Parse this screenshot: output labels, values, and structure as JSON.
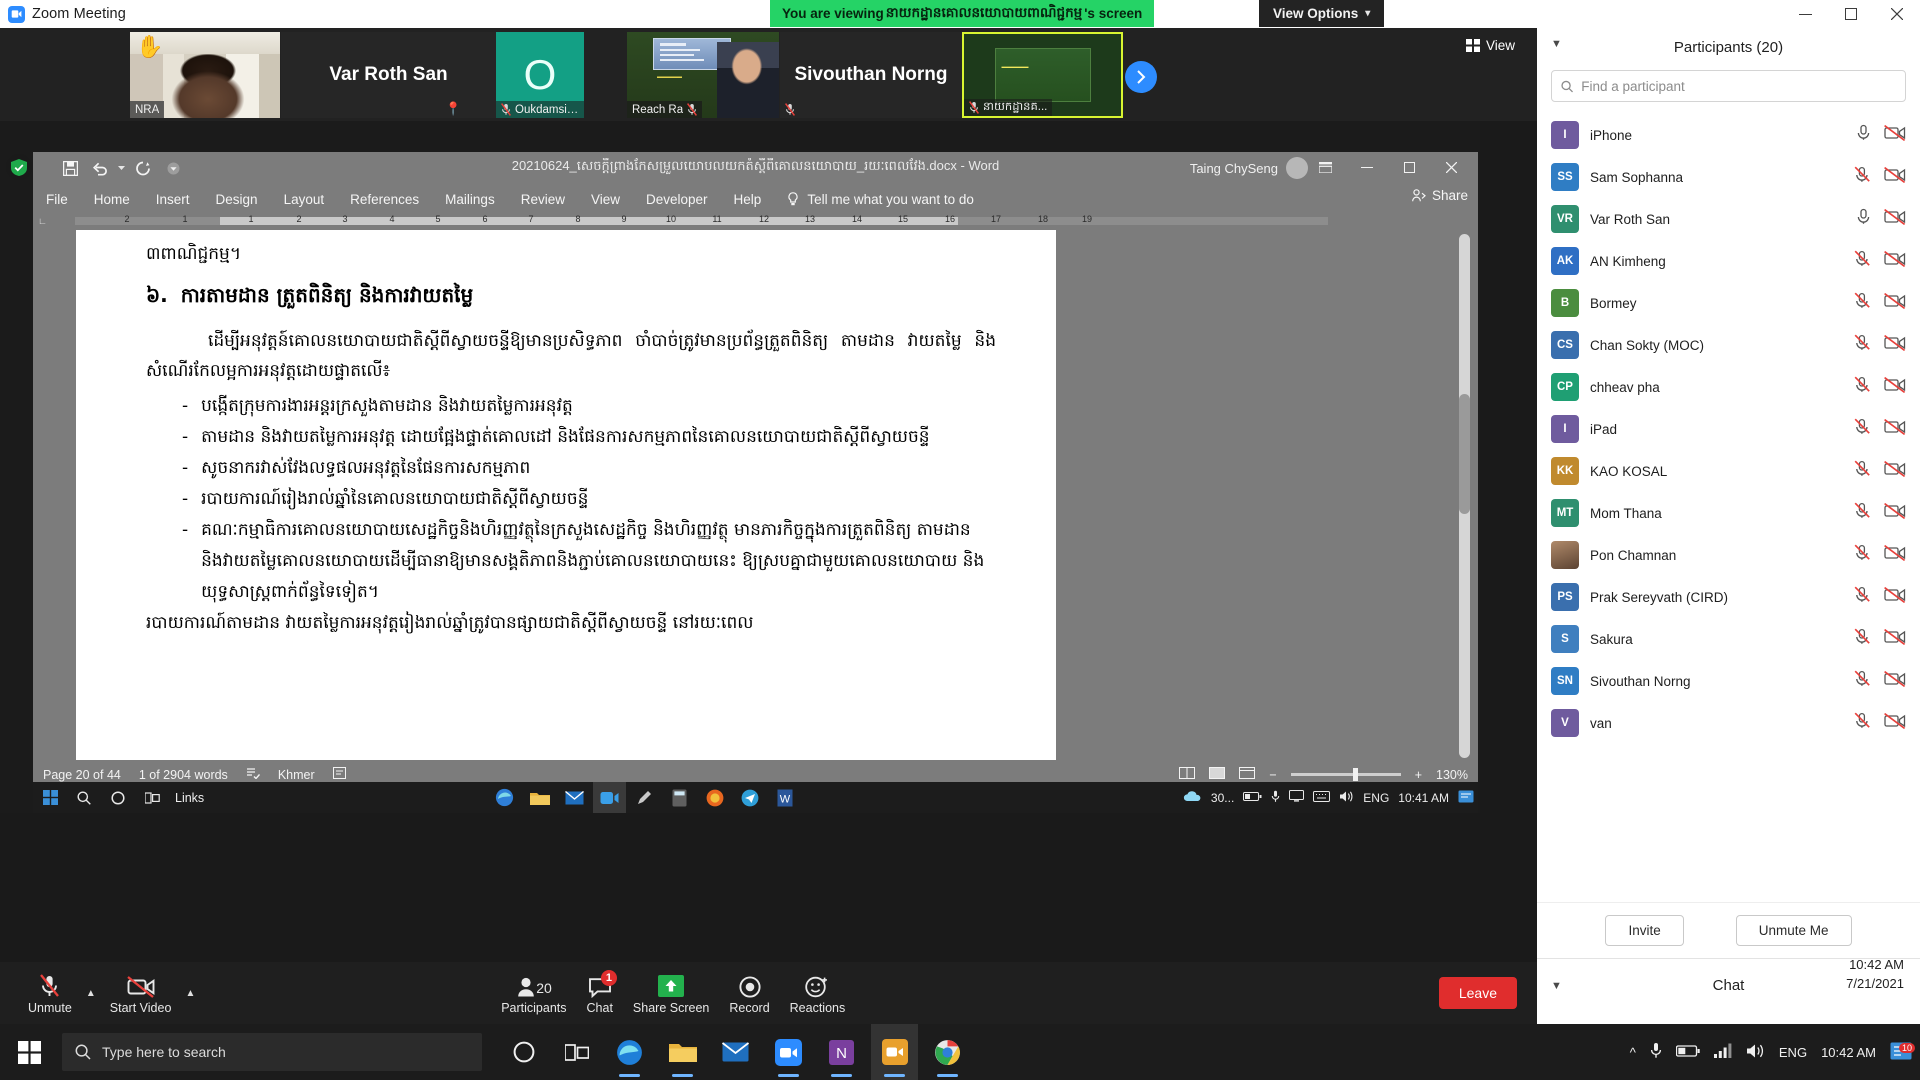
{
  "window": {
    "zoom_title": "Zoom Meeting",
    "share_banner_prefix": "You are viewing",
    "share_banner_khmer": "នាយកដ្ឋានគោលនយោបាយពាណិជ្ជកម្ម",
    "share_banner_suffix": "'s screen",
    "view_options_label": "View Options",
    "minimize_icon": "minimize-icon",
    "maximize_icon": "maximize-icon",
    "close_icon": "close-icon"
  },
  "filmstrip": {
    "view_button_label": "View",
    "next_icon": "chevron-right-icon",
    "tiles": [
      {
        "name": "NRA",
        "kind": "video",
        "hand_raised": true,
        "muted": false,
        "pinned": false
      },
      {
        "name": "Var Roth San",
        "kind": "name-only",
        "pinned": true,
        "muted": false
      },
      {
        "name": "Oukdamsidar...",
        "kind": "avatar",
        "avatar_letter": "O",
        "avatar_color": "#13a085",
        "muted": true
      },
      {
        "name": "Reach Ra",
        "kind": "video",
        "muted": true
      },
      {
        "name": "Sivouthan Norng",
        "kind": "name-only",
        "muted": true
      },
      {
        "name": "នាយកដ្ឋានគ...",
        "kind": "screen-share",
        "muted": true,
        "active_speaker": true
      }
    ]
  },
  "word": {
    "doc_title_prefix": "20210624_",
    "doc_title_khmer": "សេចក្តីព្រាងកែសម្រួលយោបលយកតំស្តីពីគោលនយោបាយ",
    "doc_title_suffix": "_រយៈពេលវែង.docx  -  Word",
    "user_name": "Taing ChySeng",
    "quick_access": [
      "save-icon",
      "undo-icon",
      "redo-icon",
      "customize-icon"
    ],
    "ribbon_tabs": [
      "File",
      "Home",
      "Insert",
      "Design",
      "Layout",
      "References",
      "Mailings",
      "Review",
      "View",
      "Developer",
      "Help"
    ],
    "tell_me": "Tell me what you want to do",
    "share_label": "Share",
    "ruler_numbers": [
      "2",
      "1",
      "1",
      "2",
      "3",
      "4",
      "5",
      "6",
      "7",
      "8",
      "9",
      "10",
      "11",
      "12",
      "13",
      "14",
      "15",
      "16",
      "17",
      "18",
      "19"
    ],
    "status": {
      "page": "Page 20 of 44",
      "words": "1 of 2904 words",
      "language": "Khmer",
      "zoom": "130%"
    },
    "document": {
      "top_fragment": "៣ពាណិជ្ជកម្ម។",
      "heading_number": "៦.",
      "heading_text": "ការតាមដាន ត្រួតពិនិត្យ និងការវាយតម្លៃ",
      "paragraph": "ដើម្បីអនុវត្តន៍គោលនយោបាយជាតិស្តីពីស្វាយចន្ទីឱ្យមានប្រសិទ្ធភាព ចាំបាច់ត្រូវមានប្រព័ន្ធត្រួតពិនិត្យ តាមដាន វាយតម្លៃ និងសំណើរកែលម្អការអនុវត្តដោយផ្ទាតលើ៖",
      "bullets": [
        "បង្កើតក្រុមការងារអន្តរក្រសួងតាមដាន និងវាយតម្លៃការអនុវត្ត",
        "តាមដាន និងវាយតម្លៃការអនុវត្ត ដោយផ្អែងផ្ទាត់គោលដៅ និងផែនការសកម្មភាពនៃគោលនយោបាយជាតិស្តីពីស្វាយចន្ទី",
        "សូចនាករវាស់វែងលទ្ធផលអនុវត្តនៃផែនការសកម្មភាព",
        "របាយការណ៍រៀងរាល់ឆ្នាំនៃគោលនយោបាយជាតិស្តីពីស្វាយចន្ទី",
        "គណៈកម្មាធិការគោលនយោបាយសេដ្ឋកិច្ចនិងហិរញ្ញវត្ថុនៃក្រសួងសេដ្ឋកិច្ច និងហិរញ្ញវត្ថុ មានភារកិច្ចក្នុងការត្រួតពិនិត្យ តាមដាន និងវាយតម្លៃគោលនយោបាយដើម្បីធានាឱ្យមានសង្គតិភាពនិងភ្ជាប់គោលនយោបាយនេះ ឱ្យស្របគ្នាជាមួយគោលនយោបាយ និងយុទ្ធសាស្ត្រពាក់ព័ន្ធទៃទៀត។"
      ],
      "clipped_line": "របាយការណ៍តាមដាន វាយតម្លៃការអនុវត្តរៀងរាល់ឆ្នាំត្រូវបានផ្សាយជាតិស្តីពីស្វាយចន្ទី នៅរយៈពេល"
    }
  },
  "inner_taskbar": {
    "links_label": "Links",
    "battery_label": "30...",
    "language": "ENG",
    "time": "10:41 AM",
    "apps": [
      "edge-icon",
      "folder-icon",
      "mail-icon",
      "zoom-icon",
      "pen-icon",
      "calc-icon",
      "firefox-icon",
      "telegram-icon",
      "word-icon"
    ]
  },
  "zoom_controls": {
    "mute": {
      "label": "Unmute",
      "icon": "mic-muted-icon"
    },
    "video": {
      "label": "Start Video",
      "icon": "camera-off-icon"
    },
    "participants": {
      "label": "Participants",
      "count": "20",
      "icon": "people-icon"
    },
    "chat": {
      "label": "Chat",
      "icon": "chat-icon",
      "badge": "1"
    },
    "share": {
      "label": "Share Screen",
      "icon": "share-up-icon"
    },
    "record": {
      "label": "Record",
      "icon": "record-icon"
    },
    "reactions": {
      "label": "Reactions",
      "icon": "smiley-icon"
    },
    "leave": {
      "label": "Leave"
    }
  },
  "panel": {
    "title": "Participants (20)",
    "search_placeholder": "Find a participant",
    "collapse_icon": "chevron-down-icon",
    "invite_label": "Invite",
    "unmute_me_label": "Unmute Me",
    "chat_title": "Chat",
    "clock_time": "10:42 AM",
    "clock_date": "7/21/2021",
    "participants": [
      {
        "name": "iPhone",
        "initials": "I",
        "color": "#6f5b9e",
        "mic": "mic-on-icon",
        "video": "video-off-icon"
      },
      {
        "name": "Sam Sophanna",
        "initials": "SS",
        "color": "#2f7dc4",
        "mic": "mic-muted-icon",
        "video": "video-off-icon"
      },
      {
        "name": "Var Roth San",
        "initials": "VR",
        "color": "#2f8f6f",
        "mic": "mic-on-icon",
        "video": "video-off-icon"
      },
      {
        "name": "AN Kimheng",
        "initials": "AK",
        "color": "#2f6fc4",
        "mic": "mic-muted-icon",
        "video": "video-off-icon"
      },
      {
        "name": "Bormey",
        "initials": "B",
        "color": "#4b8d3f",
        "mic": "mic-muted-icon",
        "video": "video-off-icon"
      },
      {
        "name": "Chan Sokty (MOC)",
        "initials": "CS",
        "color": "#3a6fae",
        "mic": "mic-muted-icon",
        "video": "video-off-icon"
      },
      {
        "name": "chheav pha",
        "initials": "CP",
        "color": "#1f9f73",
        "mic": "mic-muted-icon",
        "video": "video-off-icon"
      },
      {
        "name": "iPad",
        "initials": "I",
        "color": "#6f5b9e",
        "mic": "mic-muted-icon",
        "video": "video-off-icon"
      },
      {
        "name": "KAO KOSAL",
        "initials": "KK",
        "color": "#c08a2e",
        "mic": "mic-muted-icon",
        "video": "video-off-icon"
      },
      {
        "name": "Mom Thana",
        "initials": "MT",
        "color": "#2f8f6f",
        "mic": "mic-muted-icon",
        "video": "video-off-icon"
      },
      {
        "name": "Pon Chamnan",
        "initials": "",
        "color": "#8a6a4a",
        "photo": true,
        "mic": "mic-muted-icon",
        "video": "video-off-icon"
      },
      {
        "name": "Prak Sereyvath (CIRD)",
        "initials": "PS",
        "color": "#3a6fae",
        "mic": "mic-muted-icon",
        "video": "video-off-icon"
      },
      {
        "name": "Sakura",
        "initials": "S",
        "color": "#3f7fbf",
        "mic": "mic-muted-icon",
        "video": "video-off-icon"
      },
      {
        "name": "Sivouthan Norng",
        "initials": "SN",
        "color": "#2f7dc4",
        "mic": "mic-muted-icon",
        "video": "video-off-icon"
      },
      {
        "name": "van",
        "initials": "V",
        "color": "#6f5b9e",
        "mic": "mic-muted-icon",
        "video": "video-off-icon"
      }
    ]
  },
  "os_taskbar": {
    "search_placeholder": "Type here to search",
    "language": "ENG",
    "time": "10:42 AM",
    "notification_badge": "10",
    "apps": [
      "cortana-icon",
      "taskview-icon",
      "edge-icon",
      "explorer-icon",
      "mail-icon",
      "zoom-blue-icon",
      "onenote-icon",
      "zoom-app-icon",
      "chrome-icon"
    ]
  },
  "colors": {
    "zoom_blue": "#2d8cff",
    "share_green": "#25d366",
    "leave_red": "#e02d2d",
    "active_speaker": "#d8f531"
  }
}
